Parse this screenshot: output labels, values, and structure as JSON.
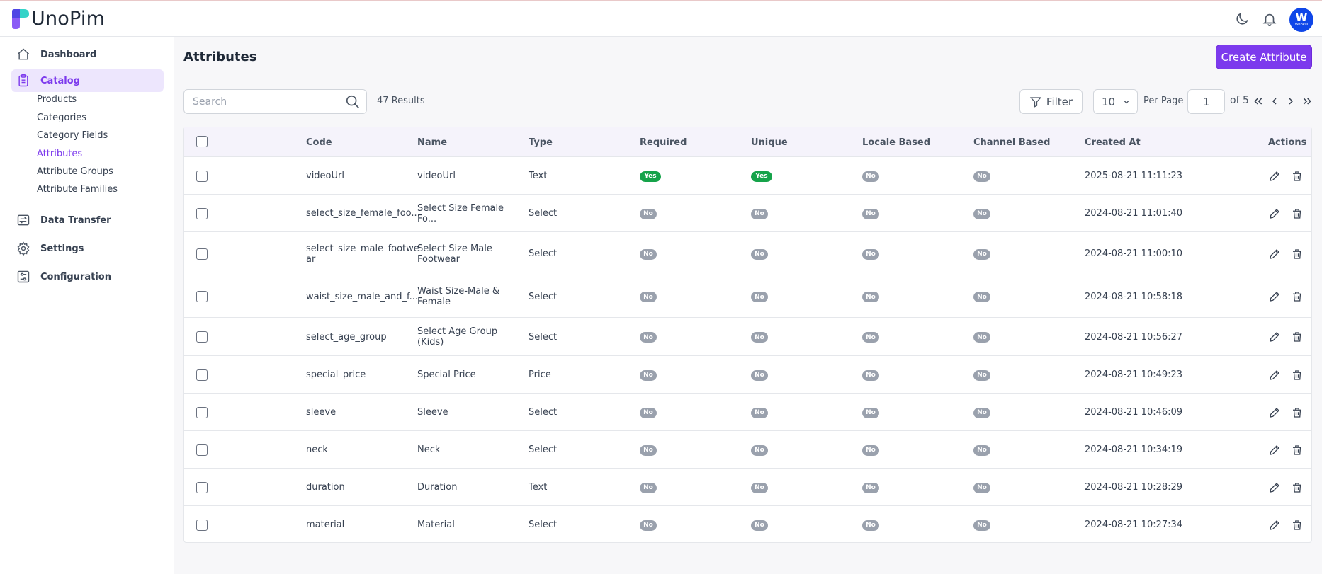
{
  "app": {
    "name": "UnoPim"
  },
  "header": {
    "avatar_initial": "W",
    "avatar_sub": "Webkul"
  },
  "sidebar": {
    "items": [
      {
        "label": "Dashboard"
      },
      {
        "label": "Catalog"
      },
      {
        "label": "Data Transfer"
      },
      {
        "label": "Settings"
      },
      {
        "label": "Configuration"
      }
    ],
    "catalog_sub": [
      {
        "label": "Products"
      },
      {
        "label": "Categories"
      },
      {
        "label": "Category Fields"
      },
      {
        "label": "Attributes"
      },
      {
        "label": "Attribute Groups"
      },
      {
        "label": "Attribute Families"
      }
    ]
  },
  "main": {
    "title": "Attributes",
    "create_label": "Create Attribute",
    "search_placeholder": "Search",
    "results": "47 Results",
    "filter_label": "Filter",
    "per_page_value": "10",
    "per_page_label": "Per Page",
    "page_value": "1",
    "of_label": "of 5"
  },
  "table": {
    "headers": {
      "code": "Code",
      "name": "Name",
      "type": "Type",
      "required": "Required",
      "unique": "Unique",
      "locale": "Locale Based",
      "channel": "Channel Based",
      "created": "Created At",
      "actions": "Actions"
    },
    "rows": [
      {
        "code": "videoUrl",
        "name": "videoUrl",
        "type": "Text",
        "required": "Yes",
        "unique": "Yes",
        "locale": "No",
        "channel": "No",
        "created": "2025-08-21 11:11:23"
      },
      {
        "code": "select_size_female_foo...",
        "name": "Select Size Female Fo...",
        "type": "Select",
        "required": "No",
        "unique": "No",
        "locale": "No",
        "channel": "No",
        "created": "2024-08-21 11:01:40"
      },
      {
        "code": "select_size_male_footwe ar",
        "name": "Select Size Male Footwear",
        "type": "Select",
        "required": "No",
        "unique": "No",
        "locale": "No",
        "channel": "No",
        "created": "2024-08-21 11:00:10"
      },
      {
        "code": "waist_size_male_and_f...",
        "name": "Waist Size-Male & Female",
        "type": "Select",
        "required": "No",
        "unique": "No",
        "locale": "No",
        "channel": "No",
        "created": "2024-08-21 10:58:18"
      },
      {
        "code": "select_age_group",
        "name": "Select Age Group (Kids)",
        "type": "Select",
        "required": "No",
        "unique": "No",
        "locale": "No",
        "channel": "No",
        "created": "2024-08-21 10:56:27"
      },
      {
        "code": "special_price",
        "name": "Special Price",
        "type": "Price",
        "required": "No",
        "unique": "No",
        "locale": "No",
        "channel": "No",
        "created": "2024-08-21 10:49:23"
      },
      {
        "code": "sleeve",
        "name": "Sleeve",
        "type": "Select",
        "required": "No",
        "unique": "No",
        "locale": "No",
        "channel": "No",
        "created": "2024-08-21 10:46:09"
      },
      {
        "code": "neck",
        "name": "Neck",
        "type": "Select",
        "required": "No",
        "unique": "No",
        "locale": "No",
        "channel": "No",
        "created": "2024-08-21 10:34:19"
      },
      {
        "code": "duration",
        "name": "Duration",
        "type": "Text",
        "required": "No",
        "unique": "No",
        "locale": "No",
        "channel": "No",
        "created": "2024-08-21 10:28:29"
      },
      {
        "code": "material",
        "name": "Material",
        "type": "Select",
        "required": "No",
        "unique": "No",
        "locale": "No",
        "channel": "No",
        "created": "2024-08-21 10:27:34"
      }
    ]
  },
  "colors": {
    "accent": "#7c3aed",
    "yes": "#16a34a",
    "no": "#9aa1ad"
  }
}
